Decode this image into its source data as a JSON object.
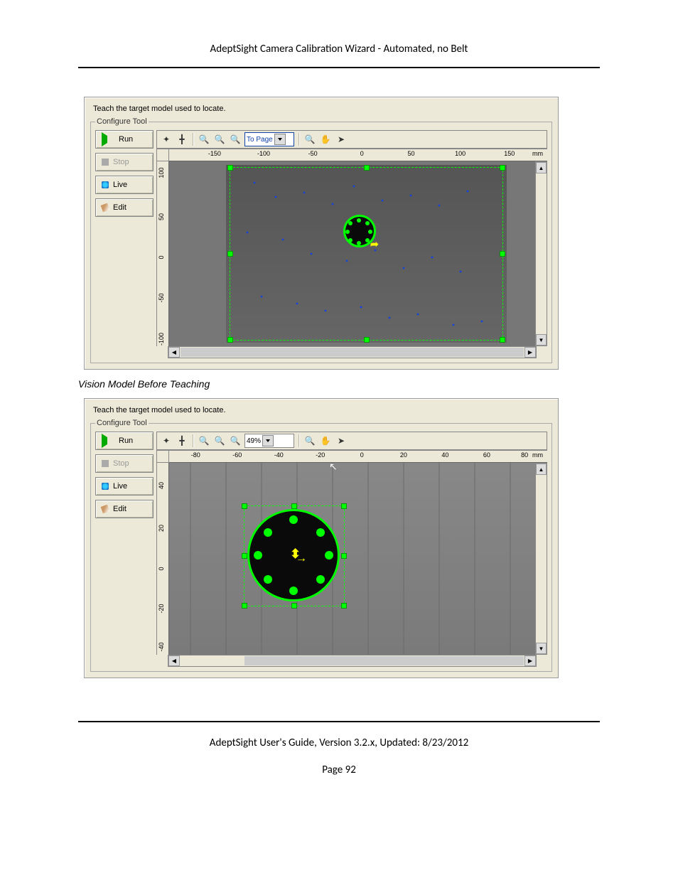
{
  "header": "AdeptSight Camera Calibration Wizard - Automated, no Belt",
  "caption1": "Vision Model Before Teaching",
  "footer": "AdeptSight User's Guide,  Version 3.2.x, Updated: 8/23/2012",
  "page": "Page 92",
  "panel1": {
    "instruction": "Teach the target model used to locate.",
    "legend": "Configure Tool",
    "buttons": {
      "run": "Run",
      "stop": "Stop",
      "live": "Live",
      "edit": "Edit"
    },
    "zoomCombo": "To Page",
    "rulerX": [
      "-150",
      "-100",
      "-50",
      "0",
      "50",
      "100",
      "150"
    ],
    "rulerUnit": "mm",
    "rulerY": [
      "100",
      "50",
      "0",
      "-50",
      "-100"
    ]
  },
  "panel2": {
    "instruction": "Teach the target model used to locate.",
    "legend": "Configure Tool",
    "buttons": {
      "run": "Run",
      "stop": "Stop",
      "live": "Live",
      "edit": "Edit"
    },
    "zoomCombo": "49%",
    "rulerX": [
      "-80",
      "-60",
      "-40",
      "-20",
      "0",
      "20",
      "40",
      "60",
      "80"
    ],
    "rulerUnit": "mm",
    "rulerY": [
      "40",
      "20",
      "0",
      "-20",
      "-40"
    ]
  }
}
